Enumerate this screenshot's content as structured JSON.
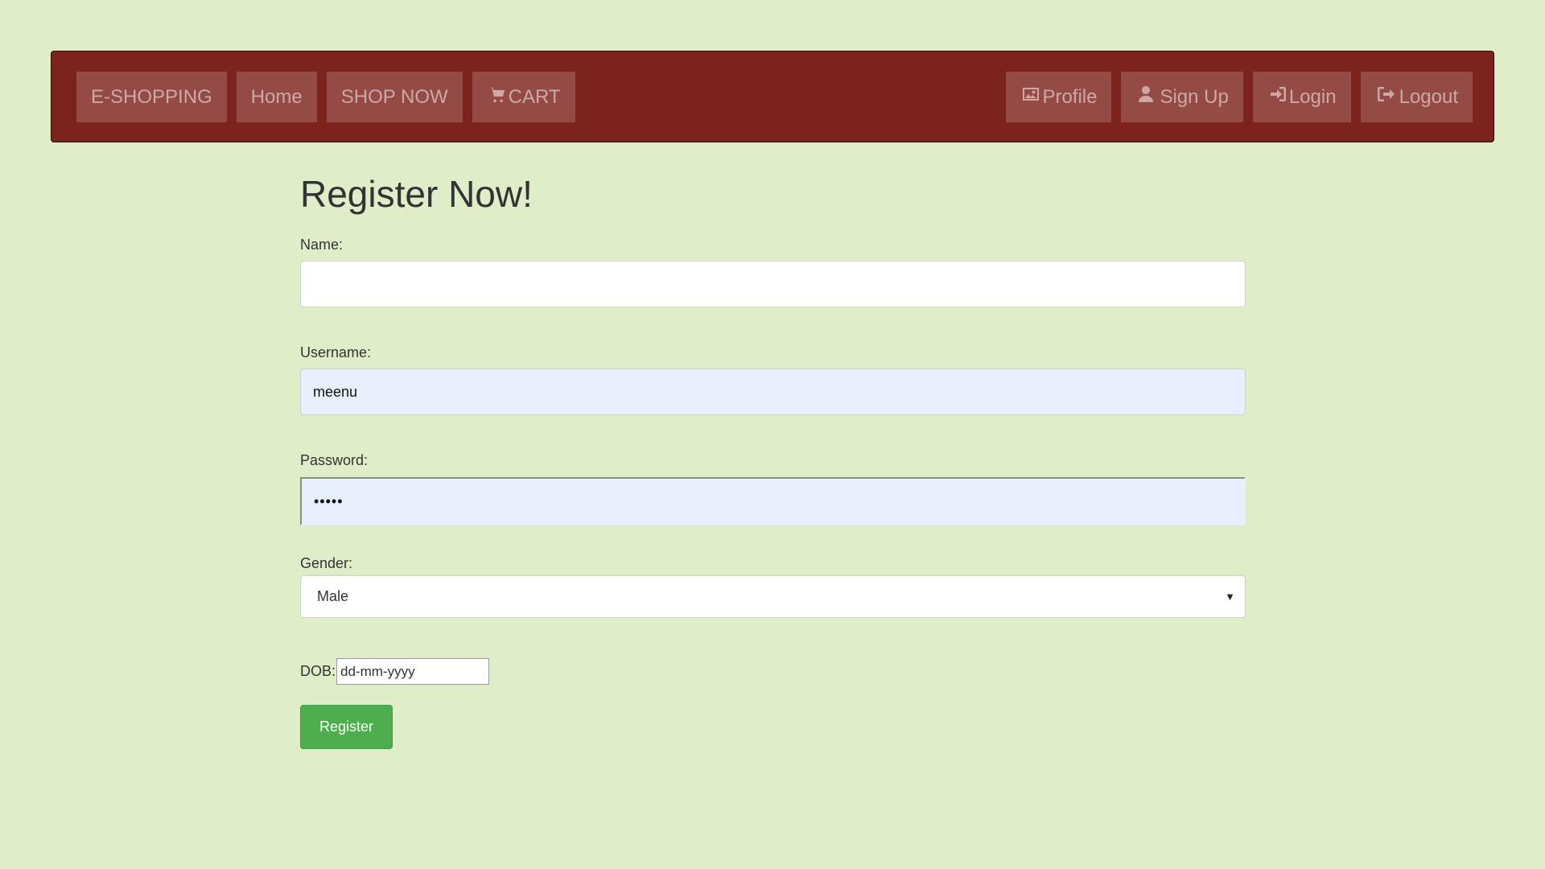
{
  "nav": {
    "brand": "E-SHOPPING",
    "home": "Home",
    "shop_now": "SHOP NOW",
    "cart": "CART",
    "profile": "Profile",
    "sign_up": "Sign Up",
    "login": "Login",
    "logout": "Logout",
    "icons": [
      "cart-icon",
      "picture-icon",
      "user-icon",
      "login-icon",
      "logout-icon"
    ]
  },
  "form": {
    "title": "Register Now!",
    "name_label": "Name:",
    "name_value": "",
    "username_label": "Username:",
    "username_value": "meenu",
    "password_label": "Password:",
    "password_value": "•••••",
    "gender_label": "Gender:",
    "gender_value": "Male",
    "dob_label": "DOB:",
    "dob_placeholder": "dd-mm-yyyy",
    "submit_label": "Register"
  },
  "colors": {
    "background": "#dfedc8",
    "navbar": "#7c231d",
    "nav_item": "#944b45",
    "register_button": "#4cae4c"
  }
}
